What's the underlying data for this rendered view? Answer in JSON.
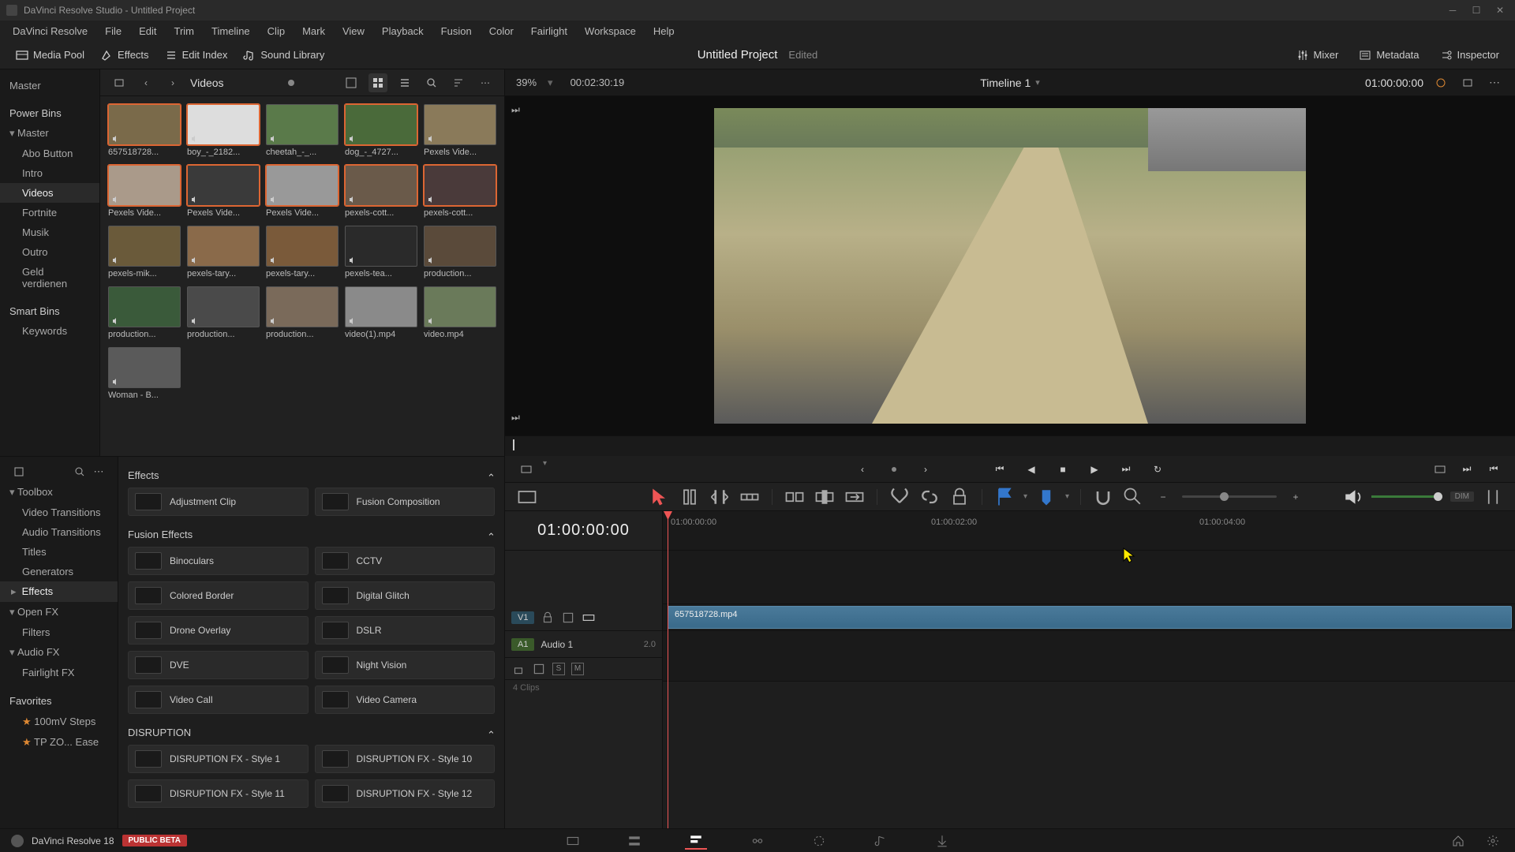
{
  "titlebar": {
    "text": "DaVinci Resolve Studio - Untitled Project"
  },
  "menu": [
    "DaVinci Resolve",
    "File",
    "Edit",
    "Trim",
    "Timeline",
    "Clip",
    "Mark",
    "View",
    "Playback",
    "Fusion",
    "Color",
    "Fairlight",
    "Workspace",
    "Help"
  ],
  "toolbar": {
    "media_pool": "Media Pool",
    "effects": "Effects",
    "edit_index": "Edit Index",
    "sound_library": "Sound Library",
    "mixer": "Mixer",
    "metadata": "Metadata",
    "inspector": "Inspector"
  },
  "project": {
    "title": "Untitled Project",
    "status": "Edited"
  },
  "viewer_bar": {
    "zoom": "39%",
    "duration": "00:02:30:19",
    "timeline": "Timeline 1",
    "tc": "01:00:00:00"
  },
  "bins": {
    "root": "Master",
    "power": "Power Bins",
    "power_root": "Master",
    "children": [
      "Abo Button",
      "Intro",
      "Videos",
      "Fortnite",
      "Musik",
      "Outro",
      "Geld verdienen"
    ],
    "smart": "Smart Bins",
    "keywords": "Keywords"
  },
  "media": {
    "header": "Videos",
    "clips": [
      {
        "n": "657518728...",
        "sel": true
      },
      {
        "n": "boy_-_2182...",
        "sel": true
      },
      {
        "n": "cheetah_-_...",
        "sel": false
      },
      {
        "n": "dog_-_4727...",
        "sel": true
      },
      {
        "n": "Pexels Vide...",
        "sel": false
      },
      {
        "n": "Pexels Vide...",
        "sel": true
      },
      {
        "n": "Pexels Vide...",
        "sel": true
      },
      {
        "n": "Pexels Vide...",
        "sel": true
      },
      {
        "n": "pexels-cott...",
        "sel": true
      },
      {
        "n": "pexels-cott...",
        "sel": true
      },
      {
        "n": "pexels-mik...",
        "sel": false
      },
      {
        "n": "pexels-tary...",
        "sel": false
      },
      {
        "n": "pexels-tary...",
        "sel": false
      },
      {
        "n": "pexels-tea...",
        "sel": false
      },
      {
        "n": "production...",
        "sel": false
      },
      {
        "n": "production...",
        "sel": false
      },
      {
        "n": "production...",
        "sel": false
      },
      {
        "n": "production...",
        "sel": false
      },
      {
        "n": "video(1).mp4",
        "sel": false
      },
      {
        "n": "video.mp4",
        "sel": false
      },
      {
        "n": "Woman - B...",
        "sel": false
      }
    ]
  },
  "fx_tree": {
    "toolbox": "Toolbox",
    "items": [
      "Video Transitions",
      "Audio Transitions",
      "Titles",
      "Generators",
      "Effects"
    ],
    "openfx": "Open FX",
    "filters": "Filters",
    "audiofx": "Audio FX",
    "fairlight": "Fairlight FX",
    "favorites": "Favorites",
    "fav_items": [
      "100mV Steps",
      "TP ZO... Ease"
    ]
  },
  "fx": {
    "header": "Effects",
    "adjustment": "Adjustment Clip",
    "fusion_comp": "Fusion Composition",
    "fusion_header": "Fusion Effects",
    "fusion": [
      "Binoculars",
      "CCTV",
      "Colored Border",
      "Digital Glitch",
      "Drone Overlay",
      "DSLR",
      "DVE",
      "Night Vision",
      "Video Call",
      "Video Camera"
    ],
    "disruption_header": "DISRUPTION",
    "disruption": [
      "DISRUPTION FX - Style 1",
      "DISRUPTION FX - Style 10",
      "DISRUPTION FX - Style 11",
      "DISRUPTION FX - Style 12"
    ]
  },
  "timeline": {
    "tc": "01:00:00:00",
    "v1": "V1",
    "a1": "A1",
    "audio_name": "Audio 1",
    "audio_ch": "2.0",
    "clips_count": "4 Clips",
    "clip_name": "657518728.mp4",
    "ticks": [
      "01:00:00:00",
      "01:00:02:00",
      "01:00:04:00"
    ]
  },
  "bottom": {
    "app": "DaVinci Resolve 18",
    "badge": "PUBLIC BETA"
  },
  "dim": "DIM"
}
